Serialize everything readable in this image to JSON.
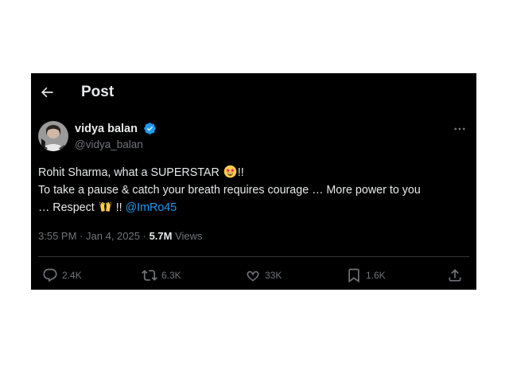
{
  "header": {
    "back_icon": "arrow-left-icon",
    "title": "Post"
  },
  "author": {
    "display_name": "vidya balan",
    "handle": "@vidya_balan",
    "verified_color": "#1d9bf0"
  },
  "tweet": {
    "line1": "Rohit Sharma, what a SUPERSTAR",
    "line1_end": "!!",
    "line2": "To take a pause & catch your breath requires courage … More power to you",
    "line3_start": "… Respect",
    "line3_mid": "!!",
    "mention": "@ImRo45",
    "emoji1": "star-struck-emoji",
    "emoji2": "raising-hands-emoji"
  },
  "meta": {
    "time": "3:55 PM",
    "separator": "·",
    "date": "Jan 4, 2025",
    "views_count": "5.7M",
    "views_label": "Views"
  },
  "actions": {
    "reply": {
      "icon": "reply-icon",
      "count": "2.4K"
    },
    "repost": {
      "icon": "repost-icon",
      "count": "6.3K"
    },
    "like": {
      "icon": "heart-icon",
      "count": "33K"
    },
    "bookmark": {
      "icon": "bookmark-icon",
      "count": "1.6K"
    },
    "share": {
      "icon": "share-icon"
    }
  },
  "colors": {
    "background": "#000000",
    "text": "#e7e9ea",
    "secondary_text": "#71767b",
    "link": "#1d9bf0",
    "divider": "#2f3336"
  }
}
